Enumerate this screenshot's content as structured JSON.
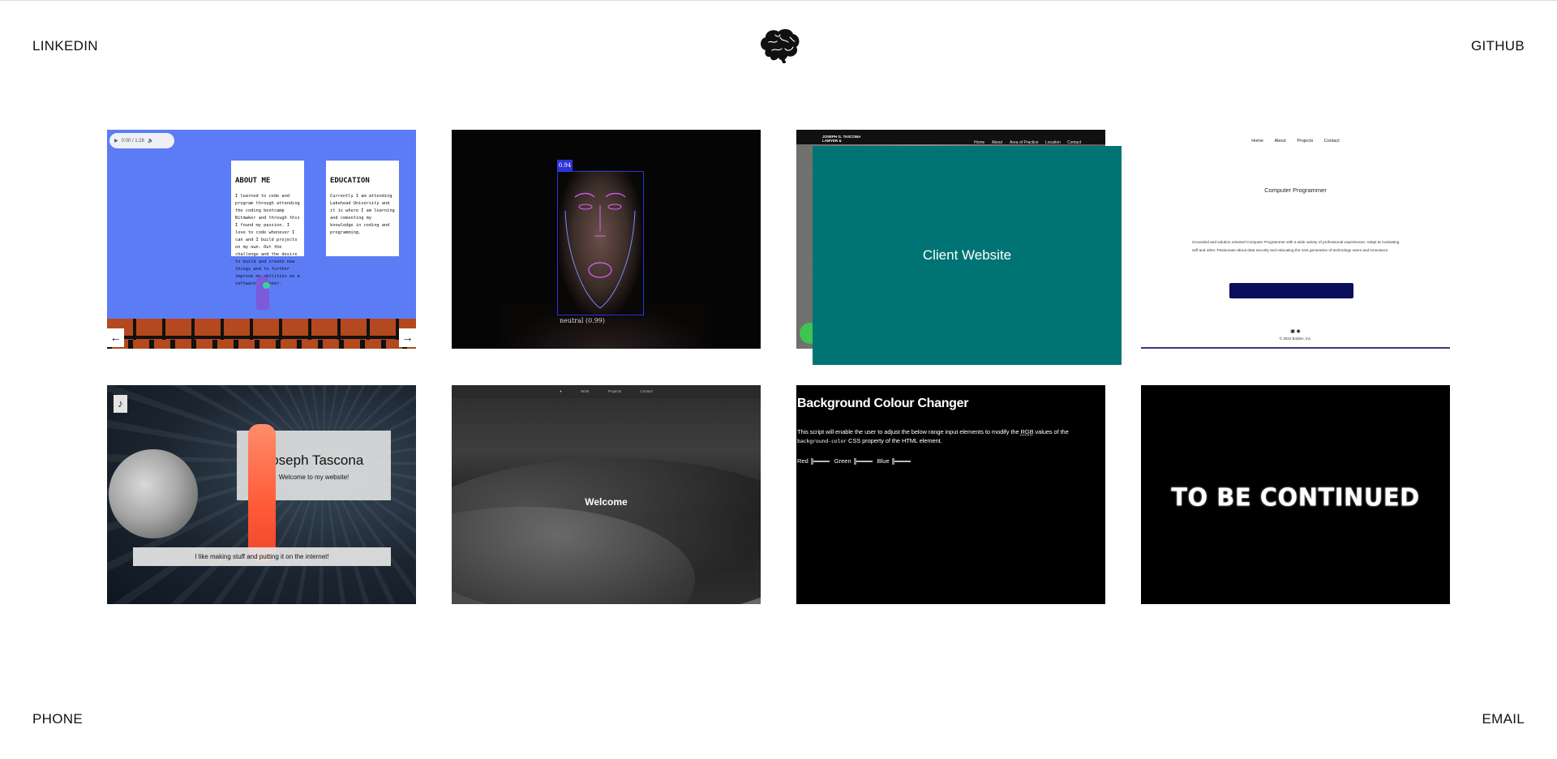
{
  "header": {
    "linkedin_label": "LINKEDIN",
    "github_label": "GITHUB",
    "logo_icon": "brain-icon"
  },
  "footer": {
    "phone_label": "PHONE",
    "email_label": "EMAIL"
  },
  "projects": [
    {
      "id": "mario-portfolio",
      "audio_time": "0:00 / 1:26",
      "about_title": "ABOUT ME",
      "about_text": "I learned to code and program through attending the coding bootcamp Bitmaker and through this I found my passion. I love to code whenever I can and I build projects on my own. Out the challenge and the desire to build and create new things and to further improve my abilities as a software engineer.",
      "education_title": "EDUCATION",
      "education_text": "Currently I am attending Lakehead University and it is where I am learning and cementing my knowledge in coding and programming.",
      "prev_icon": "arrow-left-icon",
      "next_icon": "arrow-right-icon"
    },
    {
      "id": "face-detection",
      "score": "0.94",
      "expression": "neutral (0.99)"
    },
    {
      "id": "client-website",
      "brand": "JOSEPH G. TASCONA LAWYER &",
      "nav": [
        "Home",
        "About",
        "Area of Practice",
        "Location",
        "Contact"
      ],
      "overlay_label": "Client Website"
    },
    {
      "id": "computer-programmer",
      "nav": [
        "Home",
        "About",
        "Projects",
        "Contact"
      ],
      "title": "Computer Programmer",
      "blurb": "Grounded and solution oriented Computer Programmer with a wide variety of professional experiences. Adept at motivating self and other. Passionate about data security and educating the next generation of technology users and innovators.",
      "copyright": "© 2022 Bolden, Inc."
    },
    {
      "id": "space-site",
      "name": "Joseph Tascona",
      "welcome": "Welcome to my website!",
      "tagline": "I like making stuff and putting it on the internet!",
      "music_icon": "music-note-icon"
    },
    {
      "id": "dunes-site",
      "nav": [
        "Work",
        "Projects",
        "Contact"
      ],
      "welcome": "Welcome"
    },
    {
      "id": "colour-changer",
      "title": "Background Colour Changer",
      "description_pre": "This script will enable the user to adjust the below range input elements to modify the ",
      "rgb": "RGB",
      "description_mid": " values of the ",
      "code": "background-color",
      "description_post": " CSS property of the HTML element.",
      "red_label": "Red",
      "green_label": "Green",
      "blue_label": "Blue"
    },
    {
      "id": "to-be-continued",
      "label": "TO BE CONTINUED"
    }
  ]
}
